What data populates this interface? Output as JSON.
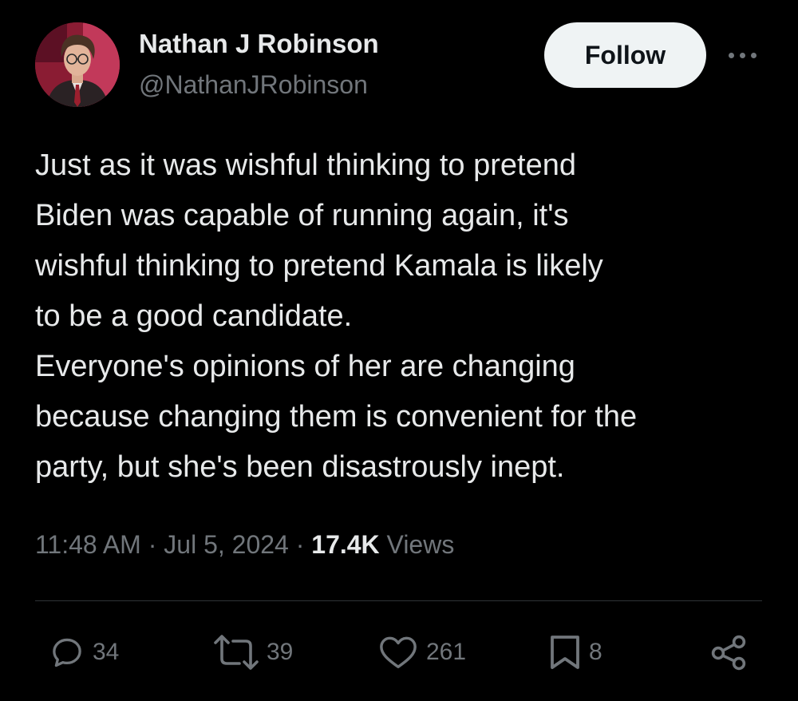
{
  "author": {
    "name": "Nathan J Robinson",
    "handle": "@NathanJRobinson",
    "avatar_icon": "profile-photo"
  },
  "header": {
    "follow_label": "Follow",
    "more_icon": "more-dots-icon"
  },
  "tweet": {
    "lines": [
      "Just as it was wishful thinking to pretend",
      "Biden was capable of running again, it's",
      "wishful thinking to pretend Kamala is likely",
      "to be a good candidate.",
      "Everyone's opinions of her are changing",
      "because changing them is convenient for the",
      "party, but she's been disastrously inept."
    ]
  },
  "meta": {
    "time": "11:48 AM",
    "separator": "·",
    "date": "Jul 5, 2024",
    "views_count": "17.4K",
    "views_label": "Views"
  },
  "actions": {
    "replies": {
      "icon": "reply-icon",
      "count": "34"
    },
    "reposts": {
      "icon": "repost-icon",
      "count": "39"
    },
    "likes": {
      "icon": "heart-icon",
      "count": "261"
    },
    "bookmarks": {
      "icon": "bookmark-icon",
      "count": "8"
    },
    "share": {
      "icon": "share-icon"
    }
  },
  "colors": {
    "background": "#000000",
    "primary_text": "#e7e9ea",
    "secondary_text": "#71767b",
    "divider": "#2f3336",
    "follow_bg": "#eff3f4"
  }
}
